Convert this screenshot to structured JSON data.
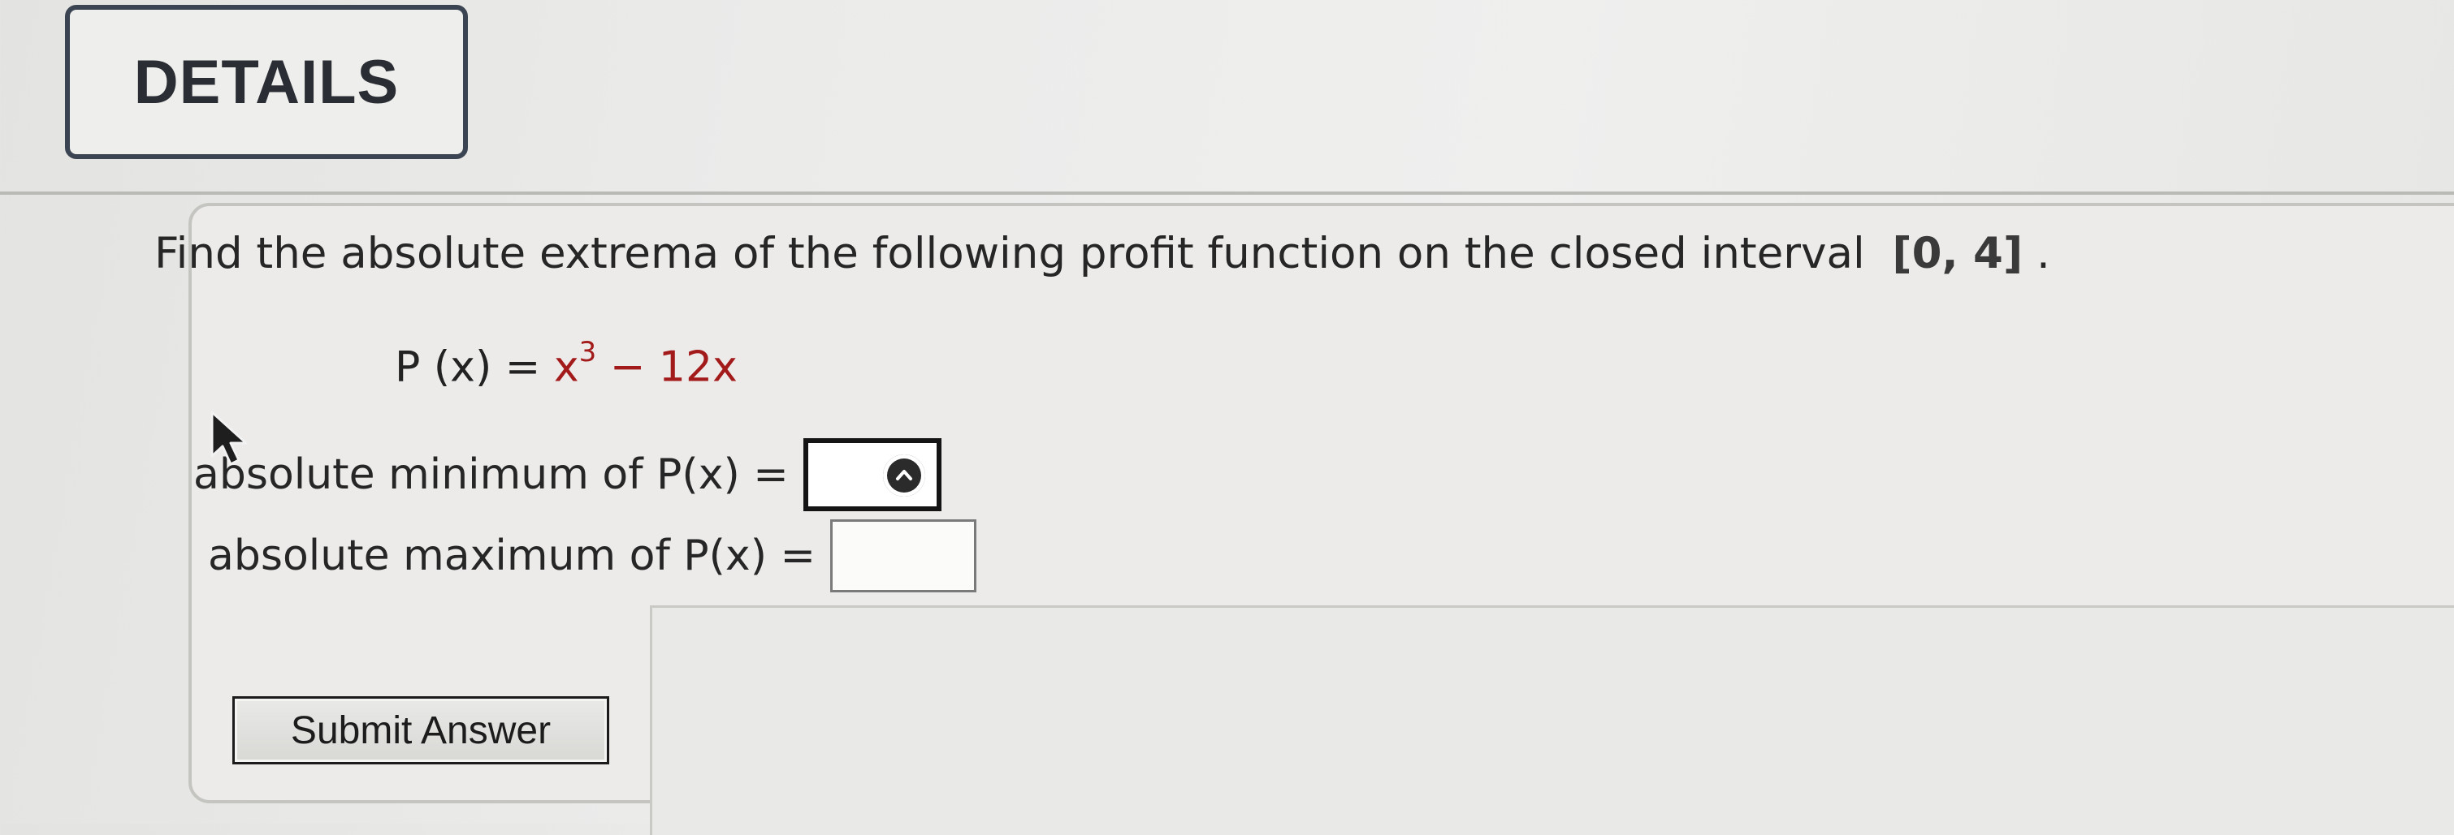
{
  "header": {
    "details_label": "DETAILS"
  },
  "question": {
    "prompt": "Find the absolute extrema of the following profit function on the closed interval",
    "interval": "[0, 4]",
    "end": "."
  },
  "function": {
    "lhs": "P (x)",
    "equals": "=",
    "base": "x",
    "exponent": "3",
    "rest": "− 12x"
  },
  "answers": {
    "min_label": "absolute minimum of P(x)",
    "max_label": "absolute maximum of P(x)",
    "equals": "=",
    "min_value": "",
    "max_value": ""
  },
  "actions": {
    "submit_label": "Submit Answer"
  },
  "colors": {
    "function_accent": "#a31a1a",
    "tab_border": "#3b4452"
  },
  "icons": {
    "answer_assist": "chevron-up-icon",
    "pointer": "mouse-pointer-icon"
  }
}
